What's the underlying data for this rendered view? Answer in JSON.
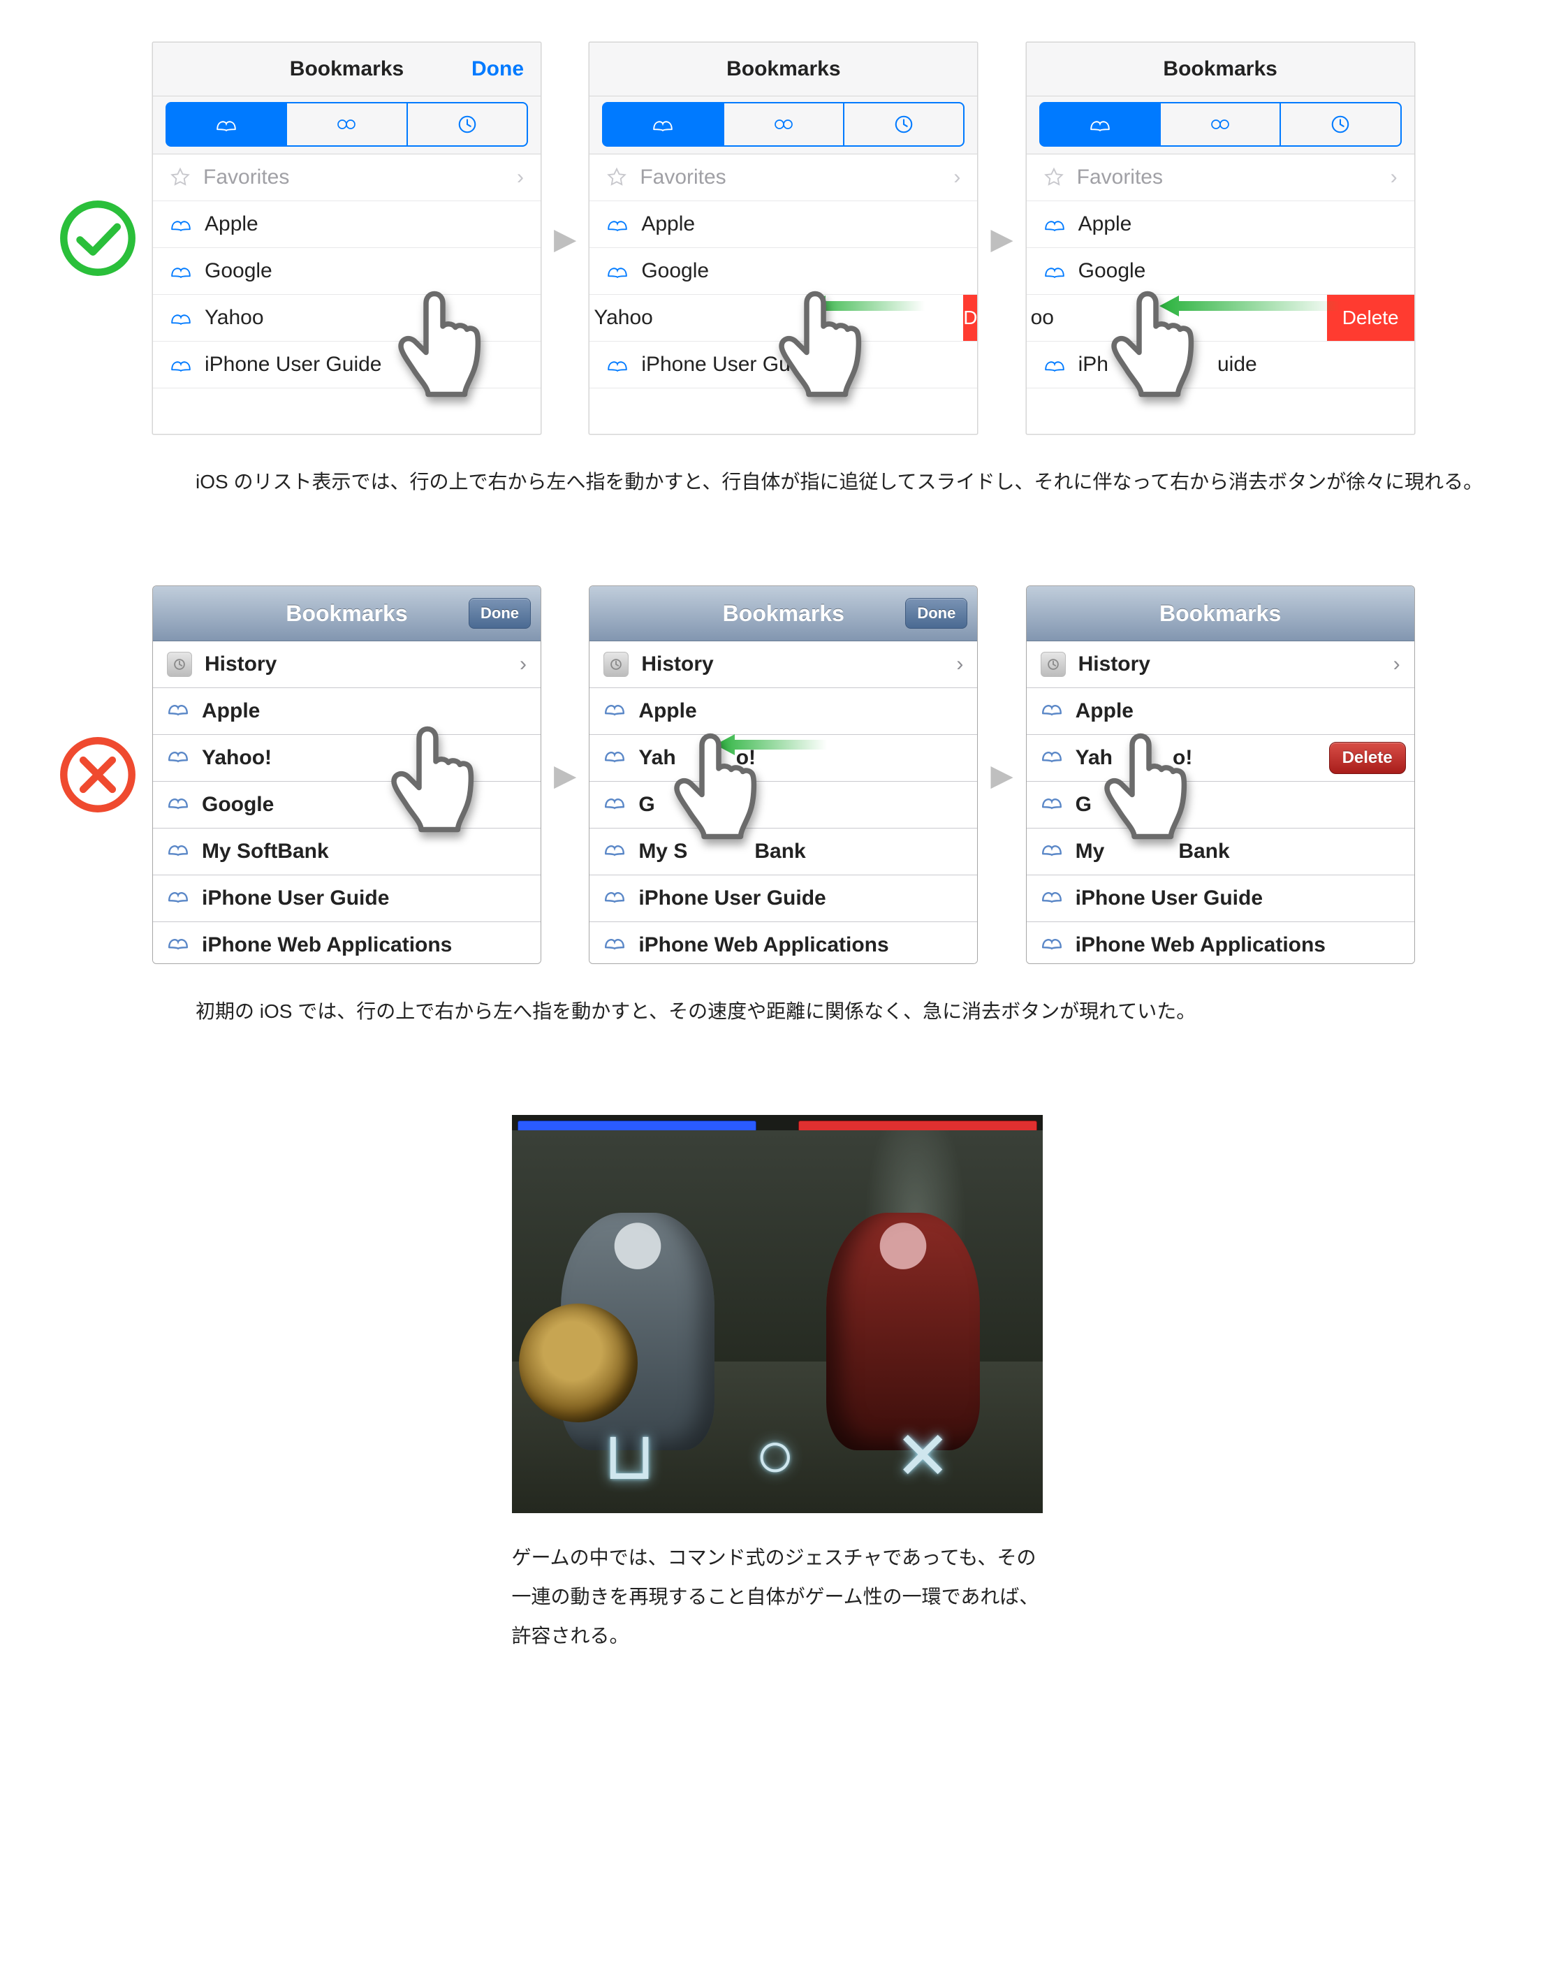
{
  "modern": {
    "title": "Bookmarks",
    "done": "Done",
    "rows": {
      "favorites": "Favorites",
      "apple": "Apple",
      "google": "Google",
      "yahoo": "Yahoo",
      "guide": "iPhone User Guide"
    },
    "delete_peek": "D",
    "delete_full": "Delete",
    "yahoo_trail": "oo",
    "guide_cut": "iPhone User Gui",
    "guide_cut2_a": "iPh",
    "guide_cut2_b": "uide",
    "caption": "iOS のリスト表示では、行の上で右から左へ指を動かすと、行自体が指に追従してスライドし、それに伴なって右から消去ボタンが徐々に現れる。"
  },
  "legacy": {
    "title": "Bookmarks",
    "done": "Done",
    "rows": {
      "history": "History",
      "apple": "Apple",
      "yahoo": "Yahoo!",
      "google": "Google",
      "softbank": "My SoftBank",
      "guide": "iPhone User Guide",
      "webapps": "iPhone Web Applications"
    },
    "yahoo_cut": "Yah",
    "yahoo_cut_tail": "o!",
    "softbank_cut_a": "My S",
    "softbank_cut_b": "Bank",
    "softbank_cut2_a": "My ",
    "softbank_cut2_b": "Bank",
    "google_cut": "G",
    "delete": "Delete",
    "caption": "初期の iOS では、行の上で右から左へ指を動かすと、その速度や距離に関係なく、急に消去ボタンが現れていた。"
  },
  "game": {
    "glyphs": {
      "square": "⊔",
      "circle": "○",
      "cross": "✕"
    },
    "caption": "ゲームの中では、コマンド式のジェスチャであっても、その一連の動きを再現すること自体がゲーム性の一環であれば、許容される。"
  }
}
